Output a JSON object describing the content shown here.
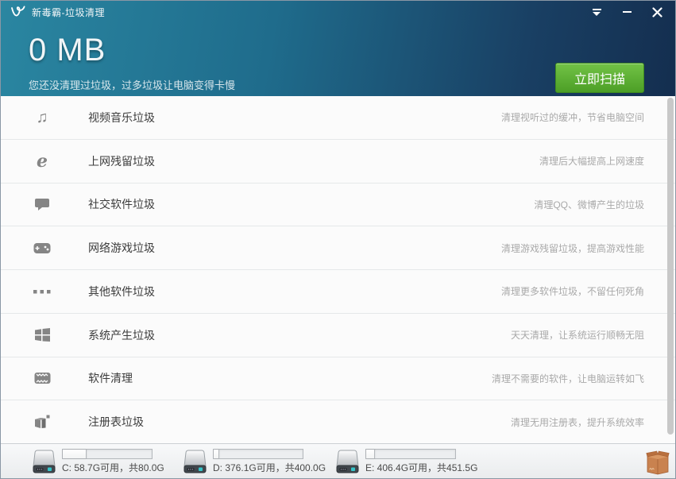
{
  "colors": {
    "header_teal": "#2a86a1",
    "header_navy": "#142e4f",
    "scan_green": "#4c9f26",
    "box_orange": "#c9824f",
    "disk_led_teal": "#35c4c9"
  },
  "window": {
    "title": "新毒霸-垃圾清理"
  },
  "header": {
    "size_value": "0 MB",
    "subtitle": "您还没清理过垃圾，过多垃圾让电脑变得卡慢",
    "scan_button": "立即扫描"
  },
  "categories": [
    {
      "icon": "music-note-icon",
      "title": "视频音乐垃圾",
      "desc": "清理视听过的缓冲，节省电脑空间"
    },
    {
      "icon": "ie-browser-icon",
      "title": "上网残留垃圾",
      "desc": "清理后大幅提高上网速度"
    },
    {
      "icon": "chat-bubble-icon",
      "title": "社交软件垃圾",
      "desc": "清理QQ、微博产生的垃圾"
    },
    {
      "icon": "gamepad-icon",
      "title": "网络游戏垃圾",
      "desc": "清理游戏残留垃圾，提高游戏性能"
    },
    {
      "icon": "ellipsis-icon",
      "title": "其他软件垃圾",
      "desc": "清理更多软件垃圾，不留任何死角"
    },
    {
      "icon": "windows-logo-icon",
      "title": "系统产生垃圾",
      "desc": "天天清理，让系统运行顺畅无阻"
    },
    {
      "icon": "software-box-icon",
      "title": "软件清理",
      "desc": "清理不需要的软件，让电脑运转如飞"
    },
    {
      "icon": "registry-cube-icon",
      "title": "注册表垃圾",
      "desc": "清理无用注册表，提升系统效率"
    }
  ],
  "statusbar": {
    "disks": [
      {
        "name": "C",
        "label": "C: 58.7G可用，共80.0G",
        "used_percent": 27
      },
      {
        "name": "D",
        "label": "D: 376.1G可用，共400.0G",
        "used_percent": 6
      },
      {
        "name": "E",
        "label": "E: 406.4G可用，共451.5G",
        "used_percent": 10
      }
    ]
  }
}
